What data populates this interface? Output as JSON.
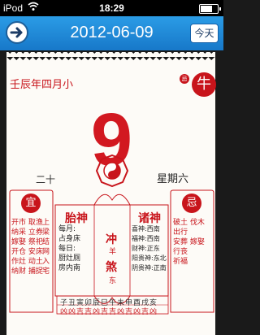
{
  "status": {
    "carrier": "iPod",
    "time": "18:29",
    "battery": 0.8
  },
  "topbar": {
    "date": "2012-06-09",
    "today": "今天"
  },
  "lunar_date": "壬辰年四月小",
  "zodiac": "牛",
  "zodiac_badge": "忌",
  "day_number": "9",
  "lunar_day": "二十",
  "weekday": "星期六",
  "board": {
    "yi_label": "宜",
    "ji_label": "忌",
    "yi_items": [
      "开市",
      "纳采",
      "嫁娶",
      "开仓",
      "作灶",
      "动土",
      "立券",
      "祭祀",
      "纳财",
      "捕捉",
      "取渔",
      "上梁",
      "安床",
      "结网",
      "畋猎",
      "入宅",
      "出行"
    ],
    "yi_cols": [
      "开市纳采嫁娶开仓作灶",
      "取渔立券祭祀安床动土",
      "立券上梁纳财入宅结网",
      "",
      "",
      ""
    ],
    "ji_cols": [
      "破土安葬祈福",
      "伐木嫁娶",
      "出行行丧"
    ],
    "taishen_label": "胎神",
    "taishen_lines": [
      "每月:",
      "占身床",
      "每日:",
      "厨灶厕",
      "房内南"
    ],
    "chong_label": "冲",
    "chong_val": "羊",
    "sha_label": "煞",
    "sha_val": "东",
    "zhushen_label": "诸神",
    "zhushen_lines": [
      "喜神:西南",
      "福神:西南",
      "财神:正东",
      "阳贵神:东北",
      "阴贵神:正南"
    ],
    "gz_top": "子丑寅卯辰巳午未申酉戌亥",
    "gz_bottom": "凶凶吉吉凶吉吉凶吉凶吉凶"
  }
}
